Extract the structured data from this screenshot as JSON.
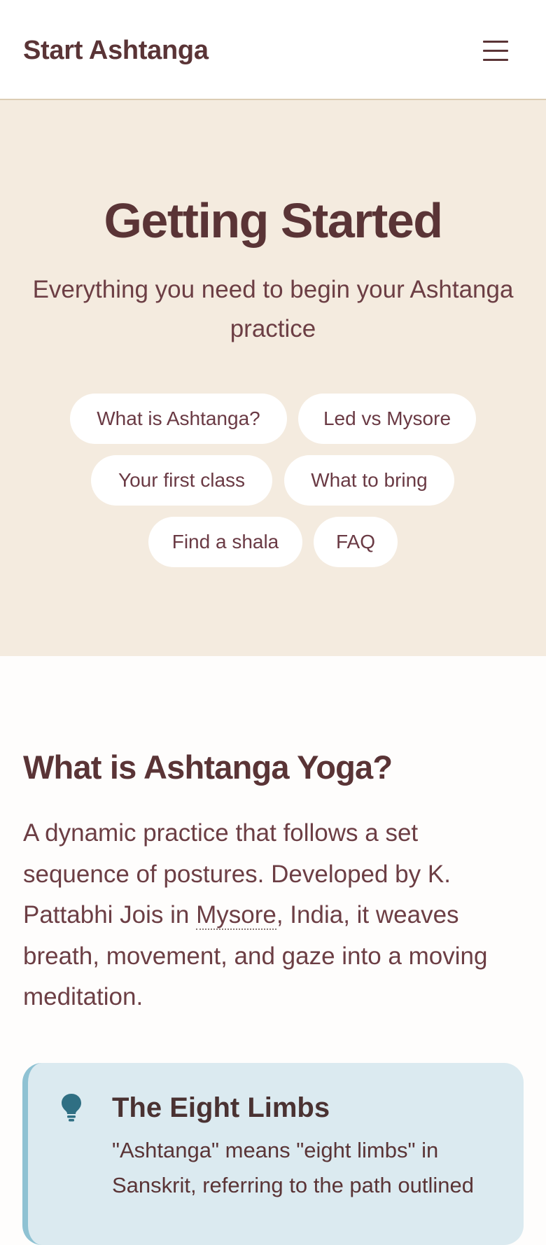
{
  "header": {
    "brand": "Start Ashtanga",
    "menu_icon": "hamburger-menu-icon"
  },
  "hero": {
    "title": "Getting Started",
    "subtitle": "Everything you need to begin your Ashtanga practice",
    "pills": [
      "What is Ashtanga?",
      "Led vs Mysore",
      "Your first class",
      "What to bring",
      "Find a shala",
      "FAQ"
    ]
  },
  "section": {
    "title": "What is Ashtanga Yoga?",
    "para_before": "A dynamic practice that follows a set sequence of postures. Developed by K. Pattabhi Jois in ",
    "para_term": "Mysore",
    "para_after": ", India, it weaves breath, movement, and gaze into a moving meditation."
  },
  "callout": {
    "icon": "lightbulb-icon",
    "title": "The Eight Limbs",
    "text": "\"Ashtanga\" means \"eight limbs\" in Sanskrit, referring to the path outlined"
  },
  "colors": {
    "text": "#5a3436",
    "hero_bg": "#f4ebdf",
    "callout_bg": "#dbeaf0",
    "callout_border": "#8fc2d3",
    "icon": "#2f6f83"
  }
}
